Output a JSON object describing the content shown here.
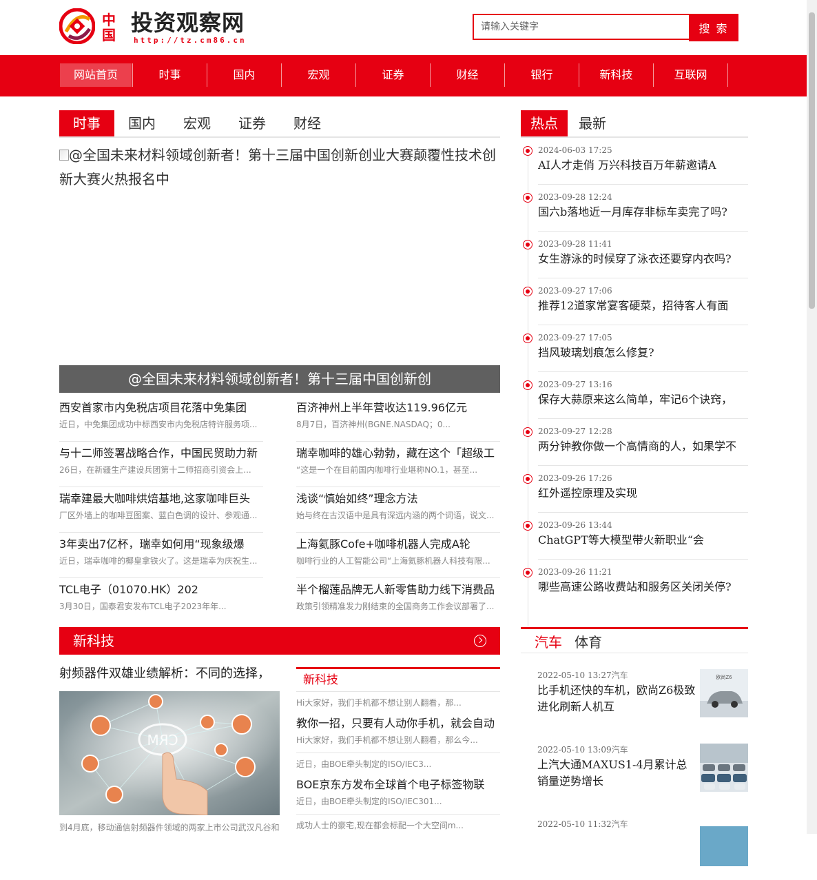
{
  "header": {
    "logo_cn": "中国",
    "site_name": "投资观察网",
    "site_url": "http://tz.cm86.cn",
    "search_placeholder": "请输入关键字",
    "search_button": "搜 索"
  },
  "nav": [
    "网站首页",
    "时事",
    "国内",
    "宏观",
    "证券",
    "财经",
    "银行",
    "新科技",
    "互联网"
  ],
  "main_tabs": [
    "时事",
    "国内",
    "宏观",
    "证券",
    "财经"
  ],
  "feature": {
    "alt_text": "@全国未来材料领域创新者！第十三届中国创新创业大赛颠覆性技术创新大赛火热报名中",
    "caption": "@全国未来材料领域创新者！第十三届中国创新创"
  },
  "news_left": [
    {
      "title": "西安首家市内免税店项目花落中免集团",
      "desc": "近日，中免集团成功中标西安市内免税店特许服务项..."
    },
    {
      "title": "与十二师签署战略合作，中国民贸助力新",
      "desc": "26日，在新疆生产建设兵团第十二师招商引资会上..."
    },
    {
      "title": "瑞幸建最大咖啡烘焙基地,这家咖啡巨头",
      "desc": "厂区外墙上的咖啡豆图案、蓝白色调的设计、参观通..."
    },
    {
      "title": "3年卖出7亿杯，瑞幸如何用“现象级爆",
      "desc": "近日，瑞幸咖啡的椰皇拿铁火了。这是瑞幸为庆祝生..."
    },
    {
      "title": "TCL电子（01070.HK）202",
      "desc": "3月30日，国泰君安发布TCL电子2023年年..."
    }
  ],
  "news_right": [
    {
      "title": "百济神州上半年营收达119.96亿元",
      "desc": "8月7日，百济神州(BGNE.NASDAQ；0..."
    },
    {
      "title": "瑞幸咖啡的雄心勃勃，藏在这个「超级工",
      "desc": "“这是一个在目前国内咖啡行业堪称NO.1，甚至..."
    },
    {
      "title": "浅谈“慎始如终”理念方法",
      "desc": "始与终在古汉语中是具有深远内涵的两个词语，说文..."
    },
    {
      "title": "上海氦豚Cofe+咖啡机器人完成A轮",
      "desc": "咖啡行业的人工智能公司“上海氦豚机器人科技有限..."
    },
    {
      "title": "半个榴莲品牌无人新零售助力线下消费品",
      "desc": "政策引领精准发力刚结束的全国商务工作会议部署了..."
    }
  ],
  "tech": {
    "section_title": "新科技",
    "headline": "射频器件双雄业绩解析：不同的选择，",
    "image_text": "CRM",
    "image_desc": "到4月底，移动通信射频器件领域的两家上市公司武汉凡谷和",
    "list_header": "新科技",
    "list": [
      {
        "desc_top": "Hi大家好，我们手机都不想让别人翻看，那...",
        "title": "教你一招，只要有人动你手机，就会自动",
        "desc": "Hi大家好，我们手机都不想让别人翻看，那么今..."
      },
      {
        "desc_top": "近日，由BOE牵头制定的ISO/IEC3...",
        "title": "BOE京东方发布全球首个电子标签物联",
        "desc": "近日，由BOE牵头制定的ISO/IEC301..."
      },
      {
        "desc_top": "成功人士的豪宅,现在都会标配一个大空间m...",
        "title": "",
        "desc": ""
      }
    ]
  },
  "right_tabs": [
    "热点",
    "最新"
  ],
  "hot": [
    {
      "time": "2024-06-03 17:25",
      "title": "AI人才走俏 万兴科技百万年薪邀请A"
    },
    {
      "time": "2023-09-28 12:24",
      "title": "国六b落地近一月库存非标车卖完了吗?"
    },
    {
      "time": "2023-09-28 11:41",
      "title": "女生游泳的时候穿了泳衣还要穿内衣吗?"
    },
    {
      "time": "2023-09-27 17:06",
      "title": "推荐12道家常宴客硬菜，招待客人有面"
    },
    {
      "time": "2023-09-27 17:05",
      "title": "挡风玻璃划痕怎么修复?"
    },
    {
      "time": "2023-09-27 13:16",
      "title": "保存大蒜原来这么简单，牢记6个诀窍，"
    },
    {
      "time": "2023-09-27 12:28",
      "title": "两分钟教你做一个高情商的人，如果学不"
    },
    {
      "time": "2023-09-26 17:26",
      "title": "红外遥控原理及实现"
    },
    {
      "time": "2023-09-26 13:44",
      "title": "ChatGPT等大模型带火新职业“会"
    },
    {
      "time": "2023-09-26 11:21",
      "title": "哪些高速公路收费站和服务区关闭关停?"
    }
  ],
  "sports_tabs": [
    "汽车",
    "体育"
  ],
  "autos": [
    {
      "time": "2022-05-10 13:27",
      "cat": "汽车",
      "title": "比手机还快的车机，欧尚Z6极致进化刷新人机互",
      "thumb_text": "欧尚Z6"
    },
    {
      "time": "2022-05-10 13:09",
      "cat": "汽车",
      "title": "上汽大通MAXUS1-4月累计总销量逆势增长",
      "thumb_text": ""
    },
    {
      "time": "2022-05-10 11:32",
      "cat": "汽车",
      "title": "",
      "thumb_text": ""
    }
  ],
  "colors": {
    "brand_red": "#e60012",
    "caption_gray": "#606060"
  }
}
